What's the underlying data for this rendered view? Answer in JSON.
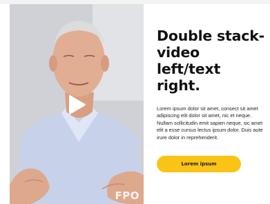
{
  "hero": {
    "headline": "Double stack-video left/text right.",
    "body": "Lorem ipsum dolor sit amet, consect sit amet adipiscing elit dolor sit amet, nic et neque. Nullam sollicitudin emit sapien neque, sic amet elit a esse cursus lectus ipsum dolor. Duis aute irure dolor in reprehenderit.",
    "cta_label": "Lorem ipsum",
    "accent_color": "#fac417"
  },
  "video": {
    "overlay_text": "FPO",
    "play_icon": "play-icon"
  }
}
